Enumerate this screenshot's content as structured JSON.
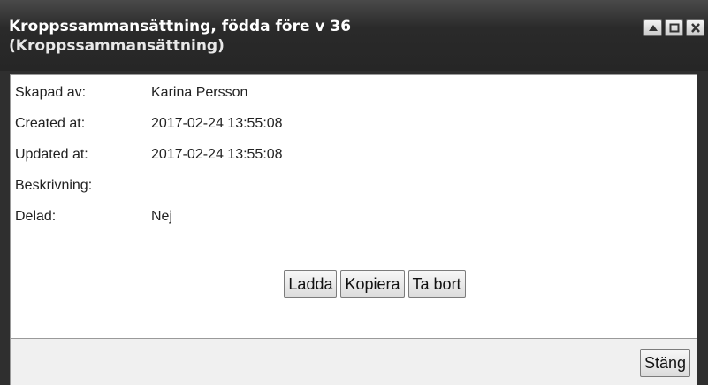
{
  "window": {
    "title_line1": "Kroppssammansättning, födda före v 36",
    "title_line2": "(Kroppssammansättning)",
    "controls": [
      {
        "name": "minimize-icon",
        "glyph": "▲"
      },
      {
        "name": "maximize-icon",
        "glyph": "□"
      },
      {
        "name": "close-icon",
        "glyph": "✕"
      }
    ]
  },
  "details": [
    {
      "label": "Skapad av:",
      "value": "Karina Persson"
    },
    {
      "label": "Created at:",
      "value": "2017-02-24 13:55:08"
    },
    {
      "label": "Updated at:",
      "value": "2017-02-24 13:55:08"
    },
    {
      "label": "Beskrivning:",
      "value": ""
    },
    {
      "label": "Delad:",
      "value": "Nej"
    }
  ],
  "actions": {
    "load": "Ladda",
    "copy": "Kopiera",
    "delete": "Ta bort"
  },
  "footer": {
    "close": "Stäng"
  }
}
